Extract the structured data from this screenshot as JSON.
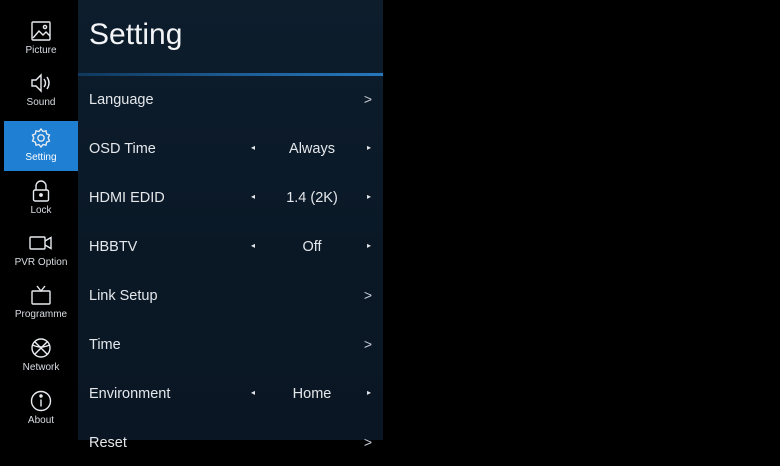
{
  "sidebar": {
    "items": [
      {
        "label": "Picture",
        "icon": "picture-icon"
      },
      {
        "label": "Sound",
        "icon": "speaker-icon"
      },
      {
        "label": "Setting",
        "icon": "gear-icon",
        "active": true
      },
      {
        "label": "Lock",
        "icon": "lock-icon"
      },
      {
        "label": "PVR Option",
        "icon": "camera-icon"
      },
      {
        "label": "Programme",
        "icon": "tv-icon"
      },
      {
        "label": "Network",
        "icon": "globe-icon"
      },
      {
        "label": "About",
        "icon": "info-icon"
      }
    ],
    "active_color": "#1f7fd3"
  },
  "panel": {
    "title": "Setting",
    "rows": [
      {
        "label": "Language",
        "type": "submenu"
      },
      {
        "label": "OSD Time",
        "type": "selector",
        "value": "Always"
      },
      {
        "label": "HDMI EDID",
        "type": "selector",
        "value": "1.4 (2K)"
      },
      {
        "label": "HBBTV",
        "type": "selector",
        "value": "Off"
      },
      {
        "label": "Link Setup",
        "type": "submenu"
      },
      {
        "label": "Time",
        "type": "submenu"
      },
      {
        "label": "Environment",
        "type": "selector",
        "value": "Home"
      },
      {
        "label": "Reset",
        "type": "submenu"
      }
    ],
    "submenu_glyph": ">",
    "left_arrow_glyph": "◂",
    "right_arrow_glyph": "▸"
  }
}
